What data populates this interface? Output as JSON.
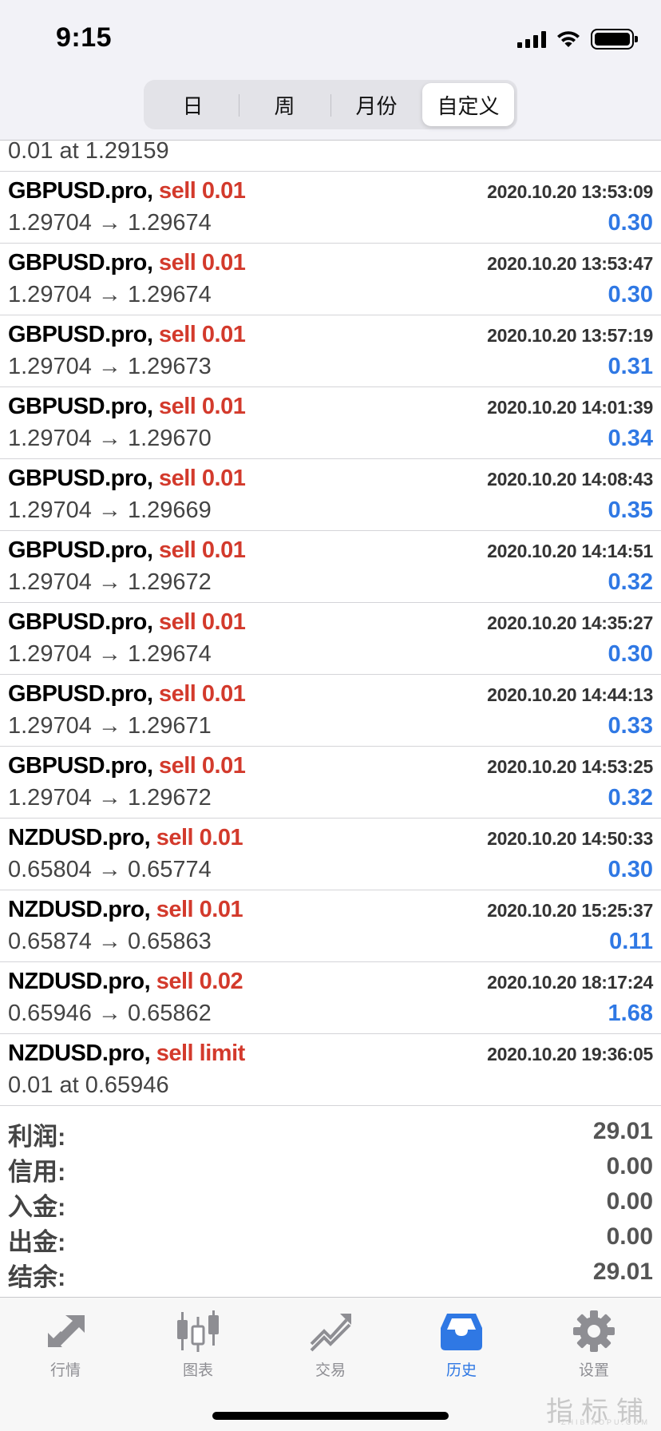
{
  "status_bar": {
    "time": "9:15"
  },
  "segments": [
    {
      "label": "日"
    },
    {
      "label": "周"
    },
    {
      "label": "月份"
    },
    {
      "label": "自定义",
      "active": true
    }
  ],
  "partial_order_text": "0.01 at 1.29159",
  "trades": [
    {
      "symbol": "GBPUSD.pro,",
      "action": "sell 0.01",
      "time": "2020.10.20 13:53:09",
      "prices": "1.29704 → 1.29674",
      "profit": "0.30"
    },
    {
      "symbol": "GBPUSD.pro,",
      "action": "sell 0.01",
      "time": "2020.10.20 13:53:47",
      "prices": "1.29704 → 1.29674",
      "profit": "0.30"
    },
    {
      "symbol": "GBPUSD.pro,",
      "action": "sell 0.01",
      "time": "2020.10.20 13:57:19",
      "prices": "1.29704 → 1.29673",
      "profit": "0.31"
    },
    {
      "symbol": "GBPUSD.pro,",
      "action": "sell 0.01",
      "time": "2020.10.20 14:01:39",
      "prices": "1.29704 → 1.29670",
      "profit": "0.34"
    },
    {
      "symbol": "GBPUSD.pro,",
      "action": "sell 0.01",
      "time": "2020.10.20 14:08:43",
      "prices": "1.29704 → 1.29669",
      "profit": "0.35"
    },
    {
      "symbol": "GBPUSD.pro,",
      "action": "sell 0.01",
      "time": "2020.10.20 14:14:51",
      "prices": "1.29704 → 1.29672",
      "profit": "0.32"
    },
    {
      "symbol": "GBPUSD.pro,",
      "action": "sell 0.01",
      "time": "2020.10.20 14:35:27",
      "prices": "1.29704 → 1.29674",
      "profit": "0.30"
    },
    {
      "symbol": "GBPUSD.pro,",
      "action": "sell 0.01",
      "time": "2020.10.20 14:44:13",
      "prices": "1.29704 → 1.29671",
      "profit": "0.33"
    },
    {
      "symbol": "GBPUSD.pro,",
      "action": "sell 0.01",
      "time": "2020.10.20 14:53:25",
      "prices": "1.29704 → 1.29672",
      "profit": "0.32"
    },
    {
      "symbol": "NZDUSD.pro,",
      "action": "sell 0.01",
      "time": "2020.10.20 14:50:33",
      "prices": "0.65804 → 0.65774",
      "profit": "0.30"
    },
    {
      "symbol": "NZDUSD.pro,",
      "action": "sell 0.01",
      "time": "2020.10.20 15:25:37",
      "prices": "0.65874 → 0.65863",
      "profit": "0.11"
    },
    {
      "symbol": "NZDUSD.pro,",
      "action": "sell 0.02",
      "time": "2020.10.20 18:17:24",
      "prices": "0.65946 → 0.65862",
      "profit": "1.68"
    }
  ],
  "pending_order": {
    "symbol": "NZDUSD.pro,",
    "action": "sell limit",
    "time": "2020.10.20 19:36:05",
    "detail": "0.01 at 0.65946"
  },
  "summary": [
    {
      "label": "利润:",
      "value": "29.01"
    },
    {
      "label": "信用:",
      "value": "0.00"
    },
    {
      "label": "入金:",
      "value": "0.00"
    },
    {
      "label": "出金:",
      "value": "0.00"
    },
    {
      "label": "结余:",
      "value": "29.01"
    }
  ],
  "tabbar": [
    {
      "label": "行情",
      "icon": "quotes-arrows-icon"
    },
    {
      "label": "图表",
      "icon": "candlestick-chart-icon"
    },
    {
      "label": "交易",
      "icon": "trade-trend-icon"
    },
    {
      "label": "历史",
      "icon": "history-inbox-icon",
      "active": true
    },
    {
      "label": "设置",
      "icon": "gear-icon"
    }
  ],
  "watermark": {
    "text": "指标铺",
    "sub": "ZHIBIAOPU.COM"
  },
  "colors": {
    "sell": "#d33a2c",
    "profit": "#2f78e4",
    "tab_active": "#2f78e4",
    "tab_inactive": "#8e8e93"
  }
}
